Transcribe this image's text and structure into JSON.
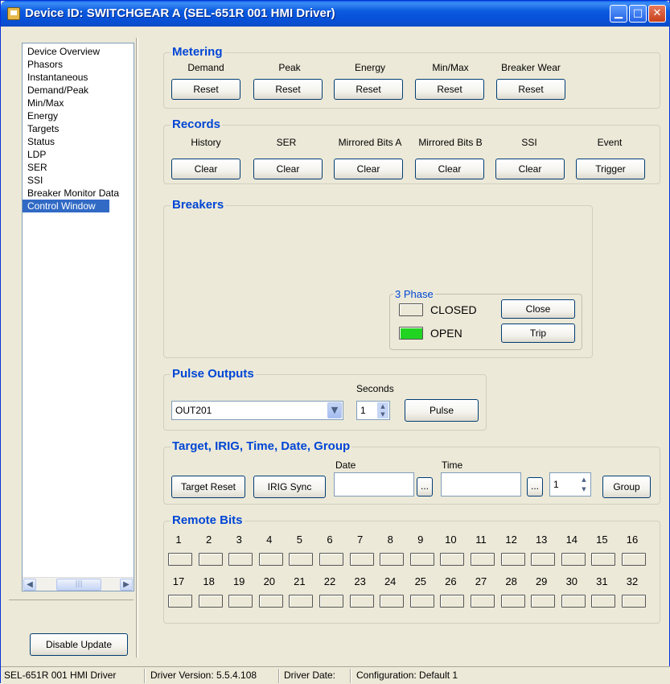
{
  "window": {
    "title": "Device ID: SWITCHGEAR A (SEL-651R 001 HMI Driver)",
    "min_icon": "minimize-icon",
    "max_icon": "maximize-icon",
    "close_icon": "close-icon",
    "min_glyph": "▁",
    "max_glyph": "□",
    "close_glyph": "✕"
  },
  "sidebar": {
    "items": [
      "Device Overview",
      "Phasors",
      "Instantaneous",
      "Demand/Peak",
      "Min/Max",
      "Energy",
      "Targets",
      "Status",
      "LDP",
      "SER",
      "SSI",
      "Breaker Monitor Data",
      "Control Window"
    ],
    "selected": "Control Window",
    "scroll_left": "◀",
    "scroll_right": "▶",
    "thumb_grip": "|||",
    "disable_update_label": "Disable Update"
  },
  "metering": {
    "title": "Metering",
    "columns": [
      {
        "label": "Demand",
        "button": "Reset"
      },
      {
        "label": "Peak",
        "button": "Reset"
      },
      {
        "label": "Energy",
        "button": "Reset"
      },
      {
        "label": "Min/Max",
        "button": "Reset"
      },
      {
        "label": "Breaker Wear",
        "button": "Reset"
      }
    ]
  },
  "records": {
    "title": "Records",
    "columns": [
      {
        "label": "History",
        "button": "Clear"
      },
      {
        "label": "SER",
        "button": "Clear"
      },
      {
        "label": "Mirrored Bits A",
        "button": "Clear"
      },
      {
        "label": "Mirrored Bits B",
        "button": "Clear"
      },
      {
        "label": "SSI",
        "button": "Clear"
      },
      {
        "label": "Event",
        "button": "Trigger"
      }
    ]
  },
  "breakers": {
    "title": "Breakers",
    "phase_title": "3 Phase",
    "closed_label": "CLOSED",
    "open_label": "OPEN",
    "close_button": "Close",
    "trip_button": "Trip",
    "closed_state": false,
    "open_state": true,
    "on_color": "#22d422"
  },
  "pulse": {
    "title": "Pulse Outputs",
    "seconds_label": "Seconds",
    "output_value": "OUT201",
    "seconds_value": "1",
    "pulse_button": "Pulse",
    "dropdown_icon": "chevron-down-icon"
  },
  "tid": {
    "title": "Target, IRIG, Time, Date, Group",
    "target_reset": "Target Reset",
    "irig_sync": "IRIG Sync",
    "date_label": "Date",
    "time_label": "Time",
    "date_value": "",
    "time_value": "",
    "ellipsis": "...",
    "group_value": "1",
    "group_button": "Group"
  },
  "remote_bits": {
    "title": "Remote Bits",
    "row1": [
      "1",
      "2",
      "3",
      "4",
      "5",
      "6",
      "7",
      "8",
      "9",
      "10",
      "11",
      "12",
      "13",
      "14",
      "15",
      "16"
    ],
    "row2": [
      "17",
      "18",
      "19",
      "20",
      "21",
      "22",
      "23",
      "24",
      "25",
      "26",
      "27",
      "28",
      "29",
      "30",
      "31",
      "32"
    ]
  },
  "statusbar": {
    "driver": "SEL-651R 001 HMI Driver",
    "version": "Driver Version: 5.5.4.108",
    "date": "Driver Date:",
    "config": "Configuration: Default 1"
  },
  "colors": {
    "accent": "#0046d5",
    "selection": "#316ac5",
    "title_bar": "#0a5fe8"
  }
}
